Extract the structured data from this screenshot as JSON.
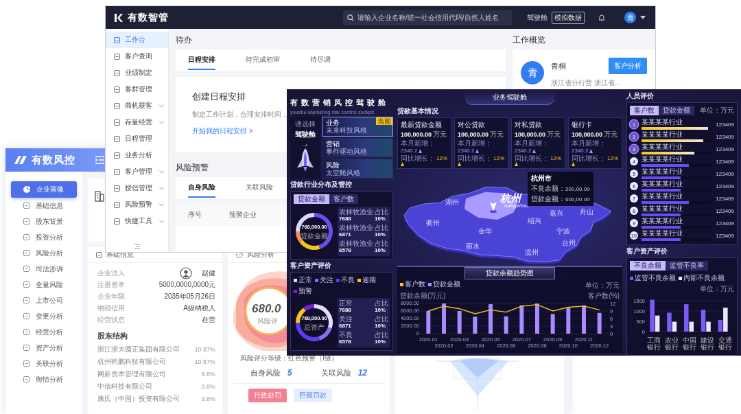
{
  "risk_app": {
    "logo": "有数风控",
    "nav": [
      {
        "label": "企业画像",
        "selected": true
      },
      {
        "label": "基础信息",
        "selected": false
      },
      {
        "label": "股东背景",
        "selected": false
      },
      {
        "label": "投资分析",
        "selected": false
      },
      {
        "label": "风险分析",
        "selected": false
      },
      {
        "label": "司法涉诉",
        "selected": false
      },
      {
        "label": "全量风险",
        "selected": false
      },
      {
        "label": "上市公司",
        "selected": false
      },
      {
        "label": "变更分析",
        "selected": false
      },
      {
        "label": "经营分析",
        "selected": false
      },
      {
        "label": "资产分析",
        "selected": false
      },
      {
        "label": "关联分析",
        "selected": false
      },
      {
        "label": "舆情分析",
        "selected": false
      }
    ],
    "basic_info": {
      "title": "基础信息",
      "fields": [
        {
          "label": "企业法人",
          "value": "赵健",
          "kind": "person"
        },
        {
          "label": "注册资本",
          "value": "5000,0000,0000元",
          "kind": "text"
        },
        {
          "label": "企业年限",
          "value": "2035年05月26日",
          "kind": "text"
        },
        {
          "label": "纳税信用",
          "value": "A级纳税人",
          "kind": "text"
        },
        {
          "label": "经营状态",
          "value": "在营",
          "kind": "text"
        }
      ],
      "shareholders_title": "股东结构",
      "shareholders": [
        {
          "name": "浙江浙大圆正集团有限公司",
          "share": "10.87%"
        },
        {
          "name": "杭州乾鹏科技有限公司",
          "share": "10.87%"
        },
        {
          "name": "网新资本管理有限公司",
          "share": "9.8%"
        },
        {
          "name": "中信科技有限公司",
          "share": "9.8%"
        },
        {
          "name": "康氏（中国）投资有限公司",
          "share": "9.8%"
        }
      ]
    },
    "risk_analysis": {
      "title": "风险分析",
      "score": "680.0",
      "score_label": "风险评",
      "grade": "风险评分等级：红色预警（I级）",
      "counts": [
        {
          "label": "自身风险",
          "value": "5"
        },
        {
          "label": "关联风险",
          "value": "12"
        }
      ],
      "tags": [
        {
          "label": "行政处罚",
          "kind": "alert"
        },
        {
          "label": "巨额罚款",
          "kind": "info"
        }
      ]
    }
  },
  "mgmt_app": {
    "logo": "有数智管",
    "search": {
      "placeholder": "请输入企业名称/统一社会信用代码/自然人姓名"
    },
    "cockpit_link": "驾驶舱",
    "data_badge": "模拟数据",
    "avatar": "青",
    "nav": [
      {
        "label": "工作台",
        "selected": true,
        "has_submenu": false
      },
      {
        "label": "客户查询",
        "selected": false,
        "has_submenu": false
      },
      {
        "label": "业绩制定",
        "selected": false,
        "has_submenu": false
      },
      {
        "label": "客群管理",
        "selected": false,
        "has_submenu": false
      },
      {
        "label": "商机获客",
        "selected": false,
        "has_submenu": true
      },
      {
        "label": "存量经营",
        "selected": false,
        "has_submenu": true
      },
      {
        "label": "日程管理",
        "selected": false,
        "has_submenu": false
      },
      {
        "label": "业务分析",
        "selected": false,
        "has_submenu": false
      },
      {
        "label": "客户管理",
        "selected": false,
        "has_submenu": true
      },
      {
        "label": "授信管理",
        "selected": false,
        "has_submenu": true
      },
      {
        "label": "风险预警",
        "selected": false,
        "has_submenu": true
      },
      {
        "label": "快捷工具",
        "selected": false,
        "has_submenu": true
      }
    ],
    "todo": {
      "title": "待办",
      "tabs": [
        {
          "label": "日程安排",
          "selected": true
        },
        {
          "label": "待完成初审",
          "selected": false
        },
        {
          "label": "待尽调",
          "selected": false
        }
      ],
      "card_title": "创建日程安排",
      "card_text": "制定工作计划，合理安排时间，",
      "card_link": "开始我的日程安排 >"
    },
    "risk": {
      "title": "风险预警",
      "tabs": [
        {
          "label": "自身风险",
          "selected": true
        },
        {
          "label": "关联风险",
          "selected": false
        }
      ],
      "columns": [
        "序号",
        "预警企业"
      ]
    },
    "overview": {
      "title": "工作概览",
      "avatar": "青",
      "name": "青桐",
      "desc": "浙江省分行营 浙江省...",
      "button": "客户分析"
    }
  },
  "cockpit": {
    "title": "有数营销风控驾驶舱",
    "subtitle": "youshu Marketing risk control cockpit",
    "switcher": {
      "hint": "请选择",
      "name": "驾驶舱",
      "arrow": "→"
    },
    "current_badge": "当前",
    "themes": [
      {
        "label": "业务",
        "subtitle": "未来科技风格",
        "selected": true
      },
      {
        "label": "营销",
        "subtitle": "事件驱动风格",
        "selected": false
      },
      {
        "label": "风险",
        "subtitle": "太空舱风格",
        "selected": false
      }
    ],
    "industry": {
      "title": "贷款行业分布及管控",
      "tabs": [
        {
          "label": "贷款金额",
          "selected": true
        },
        {
          "label": "客户数",
          "selected": false
        }
      ],
      "donut_value": "768,000.00",
      "donut_label": "贷款金额",
      "rows": [
        {
          "name": "农林牧渔业",
          "value": "7688",
          "share_label": "占比",
          "share": "10%"
        },
        {
          "name": "农林牧渔业",
          "value": "6871",
          "share_label": "占比",
          "share": "10%"
        },
        {
          "name": "农林牧渔业",
          "value": "6578",
          "share_label": "占比",
          "share": "10%"
        }
      ]
    },
    "assets": {
      "title": "客户资产评价",
      "legend": [
        {
          "label": "正常",
          "color": "#e4ddff"
        },
        {
          "label": "关注",
          "color": "#8b6cf5"
        },
        {
          "label": "不良",
          "color": "#5b3cf0"
        },
        {
          "label": "逾期",
          "color": "#f5c518"
        },
        {
          "label": "预警",
          "color": "#7a1fd6"
        }
      ],
      "donut_value": "768,000.00",
      "donut_label": "总资产",
      "rows": [
        {
          "name": "正常",
          "value": "7688",
          "share_label": "占比",
          "share": "10%"
        },
        {
          "name": "关注",
          "value": "6871",
          "share_label": "占比",
          "share": "10%"
        },
        {
          "name": "不良",
          "value": "6578",
          "share_label": "占比",
          "share": "10%"
        }
      ]
    },
    "banner": "业务驾驶舱",
    "loans": {
      "title": "贷款基本情况",
      "cards": [
        {
          "title": "最新贷款金额",
          "value": "100,000.00",
          "unit": "万元",
          "stats": [
            {
              "label": "本月新增：",
              "value": "2340.2"
            },
            {
              "label": "同比增长：",
              "value": "12%"
            }
          ]
        },
        {
          "title": "对公贷款",
          "value": "100,000.00",
          "unit": "万元",
          "stats": [
            {
              "label": "本月新增：",
              "value": "2340.2"
            },
            {
              "label": "同比增长：",
              "value": "12%"
            }
          ]
        },
        {
          "title": "对私贷款",
          "value": "100,000.00",
          "unit": "万元",
          "stats": [
            {
              "label": "本月新增：",
              "value": "2340.2"
            },
            {
              "label": "同比增长：",
              "value": "12%"
            }
          ]
        },
        {
          "title": "银行卡",
          "value": "100,000.00",
          "unit": "万元",
          "stats": [
            {
              "label": "本月新增：",
              "value": "2340.2"
            },
            {
              "label": "同比增长：",
              "value": "12%"
            }
          ]
        }
      ]
    },
    "map": {
      "cities": [
        "湖州",
        "嘉兴",
        "舟山",
        "绍兴",
        "宁波",
        "衢州",
        "金华",
        "丽水",
        "温州",
        "台州"
      ],
      "highlight": {
        "name": "杭州",
        "pinyin": "hangzhou"
      },
      "tooltip": {
        "title": "杭州市",
        "lines": [
          {
            "label": "不良余额：",
            "value": "200,00.00"
          },
          {
            "label": "贷款金额：",
            "value": "600,00.00"
          }
        ]
      }
    },
    "trend": {
      "unit": "单位：万元",
      "chart_data": {
        "type": "bar",
        "title": "贷款余额趋势图",
        "ylabel": "贷款余额(万元)",
        "y2label": "客户数(%)",
        "categories": [
          "2020.01",
          "2020.02",
          "2020.03",
          "2020.04",
          "2020.05",
          "2020.06",
          "2020.07",
          "2020.08",
          "2020.09",
          "2020.10",
          "2020.11",
          "2020.12"
        ],
        "series": [
          {
            "name": "客户数",
            "color": "#f5c518",
            "type": "line",
            "values": [
              6000,
              7300,
              6600,
              5300,
              6300,
              5700,
              7300,
              7700,
              6000,
              7000,
              7300,
              6300
            ]
          },
          {
            "name": "贷款金额",
            "color": "#a88cff",
            "type": "bar",
            "values": [
              6000,
              8000,
              6000,
              4500,
              7800,
              4600,
              7500,
              8000,
              5200,
              6800,
              7500,
              5500
            ]
          }
        ],
        "ylim": [
          0,
          8000
        ],
        "yticks": [
          {
            "value": 0,
            "label": "0"
          },
          {
            "value": 2000,
            "label": "2000.00"
          },
          {
            "value": 4000,
            "label": "4000.00"
          },
          {
            "value": 6000,
            "label": "6000.00"
          },
          {
            "value": 8000,
            "label": "8000.00"
          }
        ],
        "y2lim": [
          0,
          12
        ],
        "y2ticks": [
          0,
          3,
          6,
          9,
          12
        ],
        "grid": true
      }
    },
    "ranking": {
      "title": "人员评价",
      "tabs": [
        {
          "label": "客户数",
          "selected": true
        },
        {
          "label": "贷款金额",
          "selected": false
        }
      ],
      "unit": "单位：万元",
      "items": [
        {
          "rank": "1",
          "name": "某某某某行业",
          "value": "123409",
          "level": 0.95,
          "kind": "medal"
        },
        {
          "rank": "2",
          "name": "某某某某行业",
          "value": "123409",
          "level": 0.88,
          "kind": "medal"
        },
        {
          "rank": "3",
          "name": "某某某某行业",
          "value": "123409",
          "level": 0.75,
          "kind": "medal"
        },
        {
          "rank": "4",
          "name": "某某某某行业",
          "value": "123409",
          "level": 0.68,
          "kind": "plain"
        },
        {
          "rank": "5",
          "name": "某某某某行业",
          "value": "123409",
          "level": 0.56,
          "kind": "plain"
        },
        {
          "rank": "6",
          "name": "某某某某行业",
          "value": "123409",
          "level": 0.56,
          "kind": "plain"
        },
        {
          "rank": "7",
          "name": "某某某某行业",
          "value": "123409",
          "level": 0.68,
          "kind": "plain"
        },
        {
          "rank": "8",
          "name": "某某某某行业",
          "value": "123409",
          "level": 0.56,
          "kind": "plain"
        },
        {
          "rank": "9",
          "name": "某某某某行业",
          "value": "123409",
          "level": 0.56,
          "kind": "plain"
        },
        {
          "rank": "10",
          "name": "某某某某行业",
          "value": "123409",
          "level": 0.56,
          "kind": "plain"
        }
      ]
    },
    "bank": {
      "title": "客户资产评价",
      "tabs": [
        {
          "label": "不良余额",
          "selected": true
        },
        {
          "label": "监管不良率",
          "selected": false
        }
      ],
      "unit": "单位：万元",
      "chart_data": {
        "type": "bar",
        "categories": [
          "工商银行",
          "农业银行",
          "中国银行",
          "建设银行",
          "交通银行"
        ],
        "series": [
          {
            "name": "监管不良余额",
            "color": "#7c5cf5",
            "values": [
              1550,
              920,
              1330,
              1060,
              570
            ]
          },
          {
            "name": "内部不良余额",
            "color": "#ece6ff",
            "values": [
              780,
              480,
              480,
              480,
              1160
            ]
          }
        ],
        "ylim": [
          0,
          1600
        ],
        "yticks": [
          0,
          500,
          1000,
          1500
        ],
        "grid": true
      }
    }
  }
}
